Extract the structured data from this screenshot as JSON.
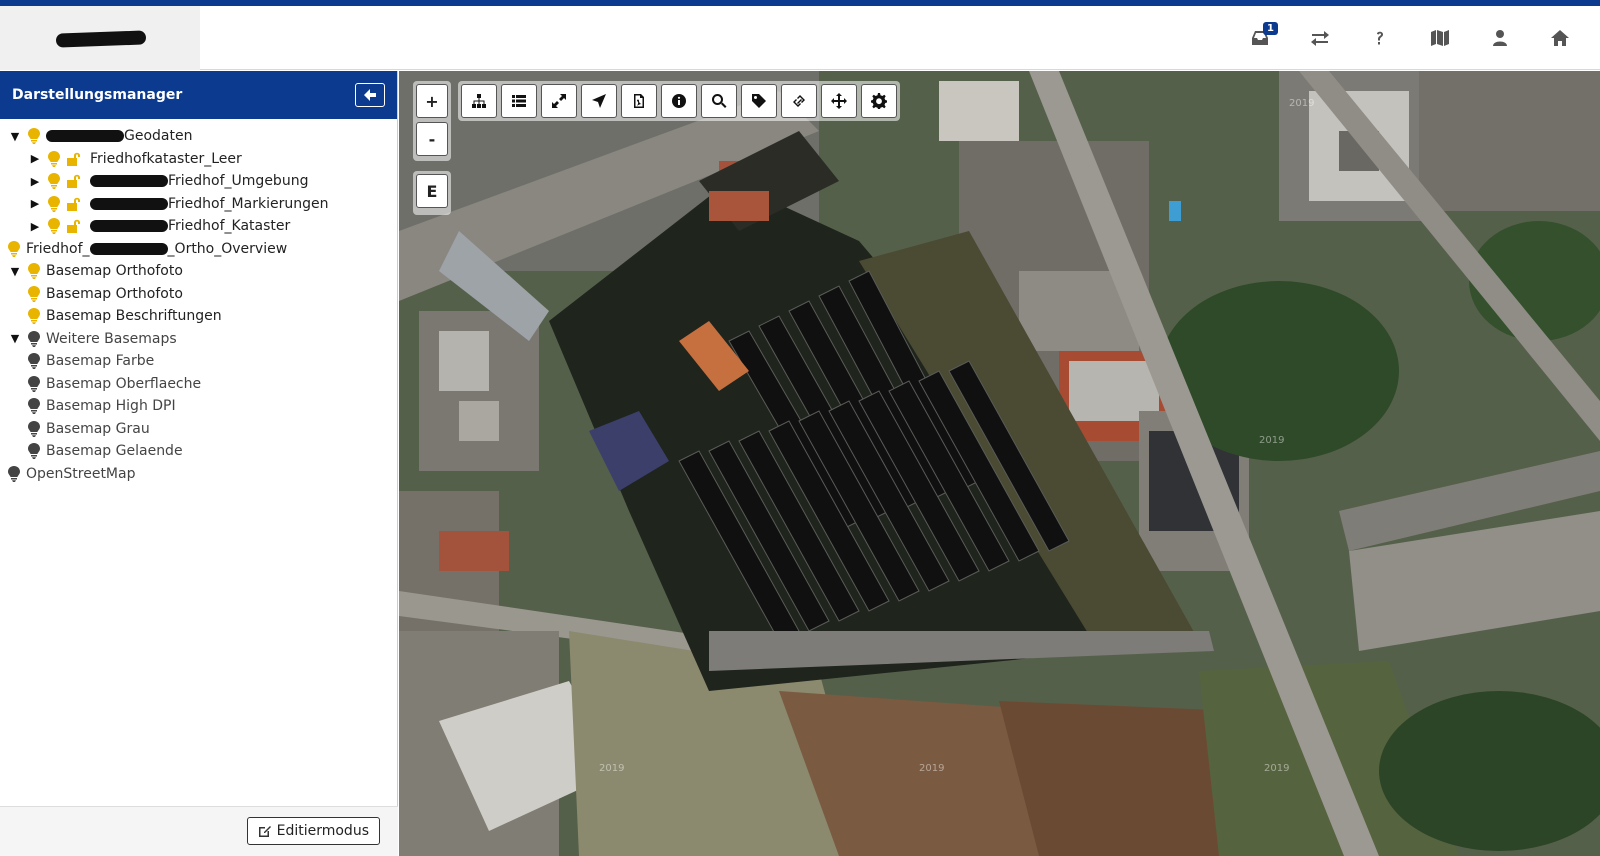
{
  "header": {
    "notification_count": "1",
    "icons": [
      "inbox-icon",
      "exchange-icon",
      "help-icon",
      "map-icon",
      "user-icon",
      "home-icon"
    ]
  },
  "sidebar": {
    "title": "Darstellungsmanager",
    "tree": {
      "geodaten": "Geodaten",
      "friedhofkataster_leer": "Friedhofkataster_Leer",
      "friedhof_umgebung": "Friedhof_Umgebung",
      "friedhof_markierungen": "Friedhof_Markierungen",
      "friedhof_kataster": "Friedhof_Kataster",
      "ortho_prefix": "Friedhof_",
      "ortho_suffix": "_Ortho_Overview",
      "basemap_orthofoto_group": "Basemap Orthofoto",
      "basemap_orthofoto": "Basemap Orthofoto",
      "basemap_beschriftungen": "Basemap Beschriftungen",
      "weitere_basemaps": "Weitere Basemaps",
      "basemap_farbe": "Basemap Farbe",
      "basemap_oberflaeche": "Basemap Oberflaeche",
      "basemap_high_dpi": "Basemap High DPI",
      "basemap_grau": "Basemap Grau",
      "basemap_gelaende": "Basemap Gelaende",
      "openstreetmap": "OpenStreetMap"
    },
    "edit_button": "Editiermodus"
  },
  "map": {
    "zoom_in": "+",
    "zoom_out": "-",
    "extent": "E",
    "imagery_year": "2019",
    "tools": [
      "sitemap-icon",
      "list-icon",
      "expand-icon",
      "navigate-icon",
      "pdf-icon",
      "info-icon",
      "search-icon",
      "tag-icon",
      "link-icon",
      "move-icon",
      "settings-icon"
    ]
  },
  "colors": {
    "brand": "#0b3a8f",
    "visible_layer": "#e8b400",
    "hidden_layer": "#444444"
  }
}
